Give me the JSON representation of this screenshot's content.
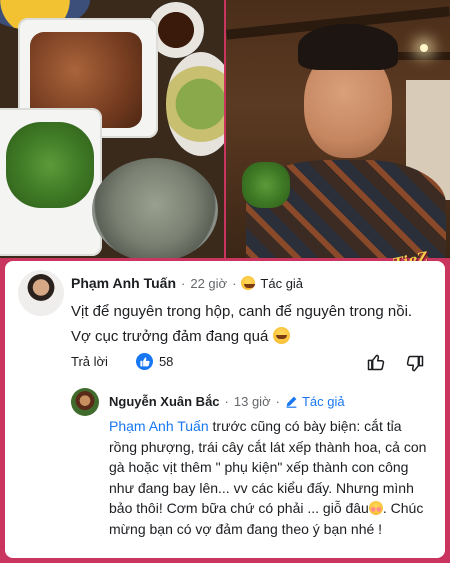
{
  "comment": {
    "author_name": "Phạm Anh Tuấn",
    "time": "22 giờ",
    "author_badge": "Tác giả",
    "text_line1": "Vịt để nguyên trong hộp, canh để nguyên trong nồi.",
    "text_line2": "Vợ cục trưởng đảm đang quá",
    "reply_label": "Trả lời",
    "like_count": "58"
  },
  "reply": {
    "author_name": "Nguyễn Xuân Bắc",
    "time": "13 giờ",
    "author_badge": "Tác giả",
    "mention": "Phạm Anh Tuấn",
    "text_part1": " trước cũng có bày biện: cắt tỉa rồng phượng, trái cây cắt lát xếp thành hoa, cả con gà hoặc vịt thêm \" phụ kiện\" xếp  thành con công như đang bay lên... vv các kiểu đấy. Nhưng mình bảo thôi! Cơm bữa chứ có phải ... giỗ đâu",
    "text_part2": ". Chúc mừng bạn có vợ đảm đang theo ý bạn nhé !"
  },
  "watermark": "TieZ",
  "colors": {
    "frame": "#c9355f",
    "link_blue": "#1877f2",
    "text": "#1c1e21",
    "muted": "#65676b"
  },
  "icons": [
    "laughing-emoji-icon",
    "like-icon",
    "thumbs-up-icon",
    "thumbs-down-icon",
    "pen-icon",
    "blush-emoji-icon"
  ]
}
